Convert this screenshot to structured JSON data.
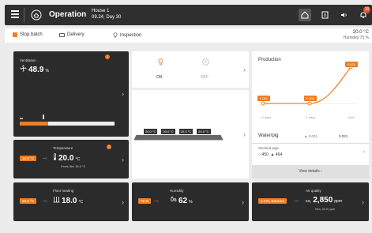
{
  "topbar": {
    "title": "Operation",
    "house": "House 1",
    "date": "09.24, Day 30",
    "notification_count": "10"
  },
  "subbar": {
    "stop_batch": "Stop batch",
    "delivery": "Delivery",
    "inspection": "Inspection",
    "temperature": "20.0 °C",
    "humidity": "Humidity 75 %"
  },
  "ventilation": {
    "label": "Ventilation",
    "value": "48.9",
    "unit": "%",
    "progress": 0.3
  },
  "temperature": {
    "label": "Temperature",
    "tag": "18.6 °C",
    "value": "20.0",
    "unit": "°C",
    "feels_like": "Feels like 18.6 °C"
  },
  "floor_heating": {
    "label": "Floor heating",
    "tag": "20.0 °C",
    "value": "18.0",
    "unit": "°C"
  },
  "lighting": {
    "on": "ON",
    "off": "OFF"
  },
  "heaters": {
    "readings": [
      "20.0 °C",
      "20.0 °C",
      "20.0 °C",
      "20.0 °C"
    ]
  },
  "humidity": {
    "label": "Humidity",
    "tag": "75 %",
    "value": "62",
    "unit": "%"
  },
  "production": {
    "title": "Production",
    "chart_labels": [
      "0.001",
      "0.001",
      "0.021"
    ],
    "x_labels": [
      "- 2 days",
      "- 1 days",
      "Now"
    ],
    "water_label": "Water/pig",
    "water_prev": "0.001",
    "water_now": "0.021",
    "stocked_label": "Stocked pigs",
    "stocked_a": "450",
    "stocked_b": "464",
    "view_details": "View details"
  },
  "air_quality": {
    "label": "Air quality",
    "tag": "3 CO₂ Sensors",
    "value": "2,850",
    "unit": "ppm",
    "nh3": "NH₃ 42.0 ppm"
  },
  "colors": {
    "accent": "#ef7d22",
    "dark_tile": "#2b2b2b",
    "topbar": "#2f2f2f"
  }
}
